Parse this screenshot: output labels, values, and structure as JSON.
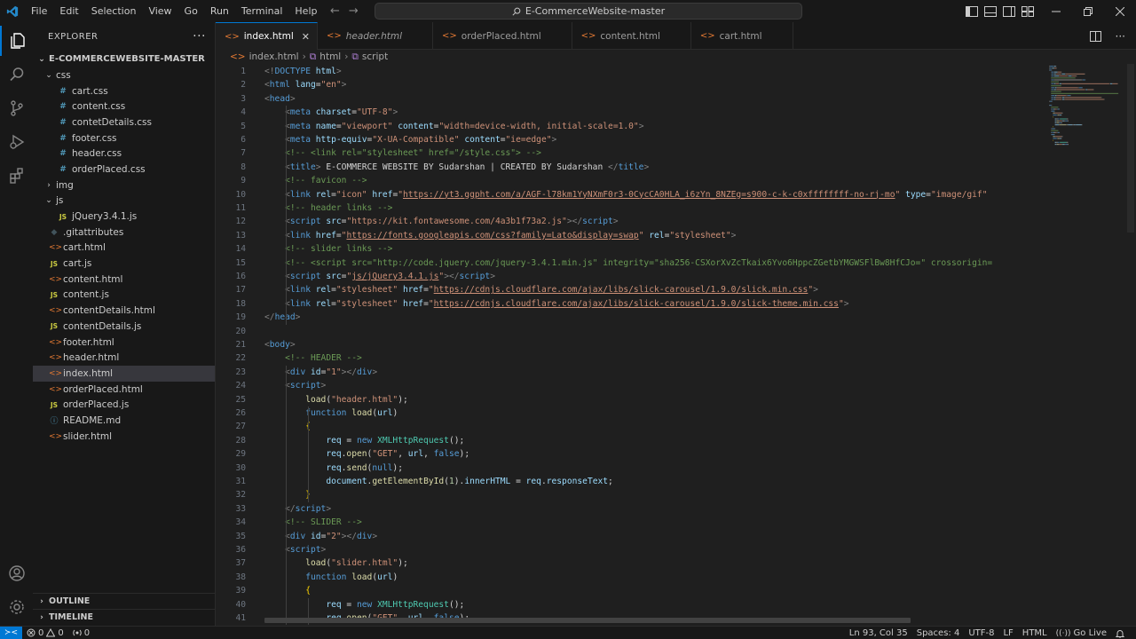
{
  "titlebar": {
    "menu": [
      "File",
      "Edit",
      "Selection",
      "View",
      "Go",
      "Run",
      "Terminal",
      "Help"
    ],
    "search_text": "E-CommerceWebsite-master",
    "window_controls": [
      "minimize",
      "maximize",
      "close"
    ]
  },
  "activity": [
    "explorer-icon",
    "search-icon",
    "source-control-icon",
    "run-debug-icon",
    "extensions-icon",
    "accounts-icon",
    "manage-gear-icon"
  ],
  "sidebar": {
    "title": "EXPLORER",
    "more": "···",
    "folder": "E-COMMERCEWEBSITE-MASTER",
    "items": [
      {
        "label": "css",
        "type": "folder-open",
        "depth": 1
      },
      {
        "label": "cart.css",
        "type": "css",
        "depth": 2
      },
      {
        "label": "content.css",
        "type": "css",
        "depth": 2
      },
      {
        "label": "contetDetails.css",
        "type": "css",
        "depth": 2
      },
      {
        "label": "footer.css",
        "type": "css",
        "depth": 2
      },
      {
        "label": "header.css",
        "type": "css",
        "depth": 2
      },
      {
        "label": "orderPlaced.css",
        "type": "css",
        "depth": 2
      },
      {
        "label": "img",
        "type": "folder-closed",
        "depth": 1
      },
      {
        "label": "js",
        "type": "folder-open",
        "depth": 1
      },
      {
        "label": "jQuery3.4.1.js",
        "type": "js",
        "depth": 2
      },
      {
        "label": ".gitattributes",
        "type": "git",
        "depth": 1
      },
      {
        "label": "cart.html",
        "type": "html",
        "depth": 1
      },
      {
        "label": "cart.js",
        "type": "js",
        "depth": 1
      },
      {
        "label": "content.html",
        "type": "html",
        "depth": 1
      },
      {
        "label": "content.js",
        "type": "js",
        "depth": 1
      },
      {
        "label": "contentDetails.html",
        "type": "html",
        "depth": 1
      },
      {
        "label": "contentDetails.js",
        "type": "js",
        "depth": 1
      },
      {
        "label": "footer.html",
        "type": "html",
        "depth": 1
      },
      {
        "label": "header.html",
        "type": "html",
        "depth": 1
      },
      {
        "label": "index.html",
        "type": "html",
        "depth": 1,
        "selected": true
      },
      {
        "label": "orderPlaced.html",
        "type": "html",
        "depth": 1
      },
      {
        "label": "orderPlaced.js",
        "type": "js",
        "depth": 1
      },
      {
        "label": "README.md",
        "type": "md",
        "depth": 1
      },
      {
        "label": "slider.html",
        "type": "html",
        "depth": 1
      }
    ],
    "outline": "OUTLINE",
    "timeline": "TIMELINE"
  },
  "tabs": [
    {
      "label": "index.html",
      "active": true,
      "italic": false
    },
    {
      "label": "header.html",
      "active": false,
      "italic": true
    },
    {
      "label": "orderPlaced.html",
      "active": false,
      "italic": false
    },
    {
      "label": "content.html",
      "active": false,
      "italic": false
    },
    {
      "label": "cart.html",
      "active": false,
      "italic": false
    }
  ],
  "breadcrumb": {
    "file": "index.html",
    "node1": "html",
    "node2": "script"
  },
  "editor": {
    "lines": [
      [
        [
          "b",
          "<!"
        ],
        [
          "t",
          "DOCTYPE"
        ],
        [
          "x",
          " "
        ],
        [
          "a",
          "html"
        ],
        [
          "b",
          ">"
        ]
      ],
      [
        [
          "b",
          "<"
        ],
        [
          "t",
          "html"
        ],
        [
          "x",
          " "
        ],
        [
          "a",
          "lang"
        ],
        [
          "x",
          "="
        ],
        [
          "s",
          "\"en\""
        ],
        [
          "b",
          ">"
        ]
      ],
      [
        [
          "b",
          "<"
        ],
        [
          "t",
          "head"
        ],
        [
          "b",
          ">"
        ]
      ],
      [
        [
          "x",
          "    "
        ],
        [
          "b",
          "<"
        ],
        [
          "t",
          "meta"
        ],
        [
          "x",
          " "
        ],
        [
          "a",
          "charset"
        ],
        [
          "x",
          "="
        ],
        [
          "s",
          "\"UTF-8\""
        ],
        [
          "b",
          ">"
        ]
      ],
      [
        [
          "x",
          "    "
        ],
        [
          "b",
          "<"
        ],
        [
          "t",
          "meta"
        ],
        [
          "x",
          " "
        ],
        [
          "a",
          "name"
        ],
        [
          "x",
          "="
        ],
        [
          "s",
          "\"viewport\""
        ],
        [
          "x",
          " "
        ],
        [
          "a",
          "content"
        ],
        [
          "x",
          "="
        ],
        [
          "s",
          "\"width=device-width, initial-scale=1.0\""
        ],
        [
          "b",
          ">"
        ]
      ],
      [
        [
          "x",
          "    "
        ],
        [
          "b",
          "<"
        ],
        [
          "t",
          "meta"
        ],
        [
          "x",
          " "
        ],
        [
          "a",
          "http-equiv"
        ],
        [
          "x",
          "="
        ],
        [
          "s",
          "\"X-UA-Compatible\""
        ],
        [
          "x",
          " "
        ],
        [
          "a",
          "content"
        ],
        [
          "x",
          "="
        ],
        [
          "s",
          "\"ie=edge\""
        ],
        [
          "b",
          ">"
        ]
      ],
      [
        [
          "x",
          "    "
        ],
        [
          "c",
          "<!-- <link rel=\"stylesheet\" href=\"/style.css\"> -->"
        ]
      ],
      [
        [
          "x",
          "    "
        ],
        [
          "b",
          "<"
        ],
        [
          "t",
          "title"
        ],
        [
          "b",
          ">"
        ],
        [
          "x",
          " E-COMMERCE WEBSITE BY Sudarshan | CREATED BY Sudarshan "
        ],
        [
          "b",
          "</"
        ],
        [
          "t",
          "title"
        ],
        [
          "b",
          ">"
        ]
      ],
      [
        [
          "x",
          "    "
        ],
        [
          "c",
          "<!-- favicon -->"
        ]
      ],
      [
        [
          "x",
          "    "
        ],
        [
          "b",
          "<"
        ],
        [
          "t",
          "link"
        ],
        [
          "x",
          " "
        ],
        [
          "a",
          "rel"
        ],
        [
          "x",
          "="
        ],
        [
          "s",
          "\"icon\""
        ],
        [
          "x",
          " "
        ],
        [
          "a",
          "href"
        ],
        [
          "x",
          "="
        ],
        [
          "s",
          "\""
        ],
        [
          "u",
          "https://yt3.ggpht.com/a/AGF-l78km1YyNXmF0r3-0CycCA0HLA_i6zYn_8NZEg=s900-c-k-c0xffffffff-no-rj-mo"
        ],
        [
          "s",
          "\""
        ],
        [
          "x",
          " "
        ],
        [
          "a",
          "type"
        ],
        [
          "x",
          "="
        ],
        [
          "s",
          "\"image/gif\""
        ]
      ],
      [
        [
          "x",
          "    "
        ],
        [
          "c",
          "<!-- header links -->"
        ]
      ],
      [
        [
          "x",
          "    "
        ],
        [
          "b",
          "<"
        ],
        [
          "t",
          "script"
        ],
        [
          "x",
          " "
        ],
        [
          "a",
          "src"
        ],
        [
          "x",
          "="
        ],
        [
          "s",
          "\"https://kit.fontawesome.com/4a3b1f73a2.js\""
        ],
        [
          "b",
          "></"
        ],
        [
          "t",
          "script"
        ],
        [
          "b",
          ">"
        ]
      ],
      [
        [
          "x",
          "    "
        ],
        [
          "b",
          "<"
        ],
        [
          "t",
          "link"
        ],
        [
          "x",
          " "
        ],
        [
          "a",
          "href"
        ],
        [
          "x",
          "="
        ],
        [
          "s",
          "\""
        ],
        [
          "u",
          "https://fonts.googleapis.com/css?family=Lato&display=swap"
        ],
        [
          "s",
          "\""
        ],
        [
          "x",
          " "
        ],
        [
          "a",
          "rel"
        ],
        [
          "x",
          "="
        ],
        [
          "s",
          "\"stylesheet\""
        ],
        [
          "b",
          ">"
        ]
      ],
      [
        [
          "x",
          "    "
        ],
        [
          "c",
          "<!-- slider links -->"
        ]
      ],
      [
        [
          "x",
          "    "
        ],
        [
          "c",
          "<!-- <script src=\"http://code.jquery.com/jquery-3.4.1.min.js\" integrity=\"sha256-CSXorXvZcTkaix6Yvo6HppcZGetbYMGWSFlBw8HfCJo=\" crossorigin="
        ]
      ],
      [
        [
          "x",
          "    "
        ],
        [
          "b",
          "<"
        ],
        [
          "t",
          "script"
        ],
        [
          "x",
          " "
        ],
        [
          "a",
          "src"
        ],
        [
          "x",
          "="
        ],
        [
          "s",
          "\""
        ],
        [
          "u",
          "js/jQuery3.4.1.js"
        ],
        [
          "s",
          "\""
        ],
        [
          "b",
          "></"
        ],
        [
          "t",
          "script"
        ],
        [
          "b",
          ">"
        ]
      ],
      [
        [
          "x",
          "    "
        ],
        [
          "b",
          "<"
        ],
        [
          "t",
          "link"
        ],
        [
          "x",
          " "
        ],
        [
          "a",
          "rel"
        ],
        [
          "x",
          "="
        ],
        [
          "s",
          "\"stylesheet\""
        ],
        [
          "x",
          " "
        ],
        [
          "a",
          "href"
        ],
        [
          "x",
          "="
        ],
        [
          "s",
          "\""
        ],
        [
          "u",
          "https://cdnjs.cloudflare.com/ajax/libs/slick-carousel/1.9.0/slick.min.css"
        ],
        [
          "s",
          "\""
        ],
        [
          "b",
          ">"
        ]
      ],
      [
        [
          "x",
          "    "
        ],
        [
          "b",
          "<"
        ],
        [
          "t",
          "link"
        ],
        [
          "x",
          " "
        ],
        [
          "a",
          "rel"
        ],
        [
          "x",
          "="
        ],
        [
          "s",
          "\"stylesheet\""
        ],
        [
          "x",
          " "
        ],
        [
          "a",
          "href"
        ],
        [
          "x",
          "="
        ],
        [
          "s",
          "\""
        ],
        [
          "u",
          "https://cdnjs.cloudflare.com/ajax/libs/slick-carousel/1.9.0/slick-theme.min.css"
        ],
        [
          "s",
          "\""
        ],
        [
          "b",
          ">"
        ]
      ],
      [
        [
          "b",
          "</"
        ],
        [
          "t",
          "head"
        ],
        [
          "b",
          ">"
        ]
      ],
      [],
      [
        [
          "b",
          "<"
        ],
        [
          "t",
          "body"
        ],
        [
          "b",
          ">"
        ]
      ],
      [
        [
          "x",
          "    "
        ],
        [
          "c",
          "<!-- HEADER -->"
        ]
      ],
      [
        [
          "x",
          "    "
        ],
        [
          "b",
          "<"
        ],
        [
          "t",
          "div"
        ],
        [
          "x",
          " "
        ],
        [
          "a",
          "id"
        ],
        [
          "x",
          "="
        ],
        [
          "s",
          "\"1\""
        ],
        [
          "b",
          "></"
        ],
        [
          "t",
          "div"
        ],
        [
          "b",
          ">"
        ]
      ],
      [
        [
          "x",
          "    "
        ],
        [
          "b",
          "<"
        ],
        [
          "t",
          "script"
        ],
        [
          "b",
          ">"
        ]
      ],
      [
        [
          "x",
          "        "
        ],
        [
          "f",
          "load"
        ],
        [
          "x",
          "("
        ],
        [
          "s",
          "\"header.html\""
        ],
        [
          "x",
          ");"
        ]
      ],
      [
        [
          "x",
          "        "
        ],
        [
          "k",
          "function"
        ],
        [
          "x",
          " "
        ],
        [
          "f",
          "load"
        ],
        [
          "x",
          "("
        ],
        [
          "v",
          "url"
        ],
        [
          "x",
          ")"
        ]
      ],
      [
        [
          "x",
          "        "
        ],
        [
          "br",
          "{"
        ]
      ],
      [
        [
          "x",
          "            "
        ],
        [
          "v",
          "req"
        ],
        [
          "x",
          " = "
        ],
        [
          "k",
          "new"
        ],
        [
          "x",
          " "
        ],
        [
          "y",
          "XMLHttpRequest"
        ],
        [
          "x",
          "();"
        ]
      ],
      [
        [
          "x",
          "            "
        ],
        [
          "v",
          "req"
        ],
        [
          "x",
          "."
        ],
        [
          "f",
          "open"
        ],
        [
          "x",
          "("
        ],
        [
          "s",
          "\"GET\""
        ],
        [
          "x",
          ", "
        ],
        [
          "v",
          "url"
        ],
        [
          "x",
          ", "
        ],
        [
          "k",
          "false"
        ],
        [
          "x",
          ");"
        ]
      ],
      [
        [
          "x",
          "            "
        ],
        [
          "v",
          "req"
        ],
        [
          "x",
          "."
        ],
        [
          "f",
          "send"
        ],
        [
          "x",
          "("
        ],
        [
          "k",
          "null"
        ],
        [
          "x",
          ");"
        ]
      ],
      [
        [
          "x",
          "            "
        ],
        [
          "v",
          "document"
        ],
        [
          "x",
          "."
        ],
        [
          "f",
          "getElementById"
        ],
        [
          "x",
          "("
        ],
        [
          "n",
          "1"
        ],
        [
          "x",
          ")."
        ],
        [
          "v",
          "innerHTML"
        ],
        [
          "x",
          " = "
        ],
        [
          "v",
          "req"
        ],
        [
          "x",
          "."
        ],
        [
          "v",
          "responseText"
        ],
        [
          "x",
          ";"
        ]
      ],
      [
        [
          "x",
          "        "
        ],
        [
          "br",
          "}"
        ]
      ],
      [
        [
          "x",
          "    "
        ],
        [
          "b",
          "</"
        ],
        [
          "t",
          "script"
        ],
        [
          "b",
          ">"
        ]
      ],
      [
        [
          "x",
          "    "
        ],
        [
          "c",
          "<!-- SLIDER -->"
        ]
      ],
      [
        [
          "x",
          "    "
        ],
        [
          "b",
          "<"
        ],
        [
          "t",
          "div"
        ],
        [
          "x",
          " "
        ],
        [
          "a",
          "id"
        ],
        [
          "x",
          "="
        ],
        [
          "s",
          "\"2\""
        ],
        [
          "b",
          "></"
        ],
        [
          "t",
          "div"
        ],
        [
          "b",
          ">"
        ]
      ],
      [
        [
          "x",
          "    "
        ],
        [
          "b",
          "<"
        ],
        [
          "t",
          "script"
        ],
        [
          "b",
          ">"
        ]
      ],
      [
        [
          "x",
          "        "
        ],
        [
          "f",
          "load"
        ],
        [
          "x",
          "("
        ],
        [
          "s",
          "\"slider.html\""
        ],
        [
          "x",
          ");"
        ]
      ],
      [
        [
          "x",
          "        "
        ],
        [
          "k",
          "function"
        ],
        [
          "x",
          " "
        ],
        [
          "f",
          "load"
        ],
        [
          "x",
          "("
        ],
        [
          "v",
          "url"
        ],
        [
          "x",
          ")"
        ]
      ],
      [
        [
          "x",
          "        "
        ],
        [
          "br",
          "{"
        ]
      ],
      [
        [
          "x",
          "            "
        ],
        [
          "v",
          "req"
        ],
        [
          "x",
          " = "
        ],
        [
          "k",
          "new"
        ],
        [
          "x",
          " "
        ],
        [
          "y",
          "XMLHttpRequest"
        ],
        [
          "x",
          "();"
        ]
      ],
      [
        [
          "x",
          "            "
        ],
        [
          "v",
          "req"
        ],
        [
          "x",
          "."
        ],
        [
          "f",
          "open"
        ],
        [
          "x",
          "("
        ],
        [
          "s",
          "\"GET\""
        ],
        [
          "x",
          ", "
        ],
        [
          "v",
          "url"
        ],
        [
          "x",
          ", "
        ],
        [
          "k",
          "false"
        ],
        [
          "x",
          ");"
        ]
      ]
    ]
  },
  "status": {
    "errors": "0",
    "warnings": "0",
    "ports": "0",
    "position": "Ln 93, Col 35",
    "spaces": "Spaces: 4",
    "encoding": "UTF-8",
    "eol": "LF",
    "language": "HTML",
    "golive": "Go Live"
  },
  "colors": {
    "accent": "#0078d4",
    "background": "#1e1e1e",
    "sidebar": "#181818"
  }
}
